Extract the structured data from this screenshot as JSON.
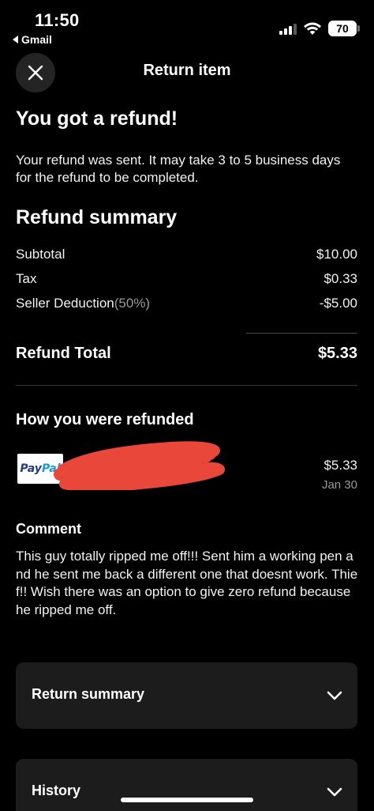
{
  "status_bar": {
    "time": "11:50",
    "back_app": "Gmail",
    "battery": "70"
  },
  "header": {
    "title": "Return item",
    "close_icon": "close-icon"
  },
  "refund": {
    "title": "You got a refund!",
    "message": "Your refund was sent. It may take 3 to 5 business days for the refund to be completed."
  },
  "summary": {
    "title": "Refund summary",
    "rows": [
      {
        "label": "Subtotal",
        "note": "",
        "value": "$10.00"
      },
      {
        "label": "Tax",
        "note": "",
        "value": "$0.33"
      },
      {
        "label": "Seller Deduction",
        "note": "(50%)",
        "value": "-$5.00"
      }
    ],
    "total_label": "Refund Total",
    "total_value": "$5.33"
  },
  "refund_method": {
    "title": "How you were refunded",
    "logo_text_1": "Pay",
    "logo_text_2": "Pal",
    "amount": "$5.33",
    "date": "Jan 30"
  },
  "comment": {
    "title": "Comment",
    "text": "This guy totally ripped me off!!! Sent him a working pen and he sent me back a different one that doesnt work. Thief!! Wish there was an option to give zero refund because he ripped me off."
  },
  "accordions": [
    {
      "label": "Return summary",
      "icon": "chevron-down-icon"
    },
    {
      "label": "History",
      "icon": "chevron-down-icon"
    }
  ],
  "colors": {
    "background": "#000000",
    "card": "#1c1c1c",
    "muted_text": "#9a9a9a",
    "redaction": "#e8473a"
  }
}
